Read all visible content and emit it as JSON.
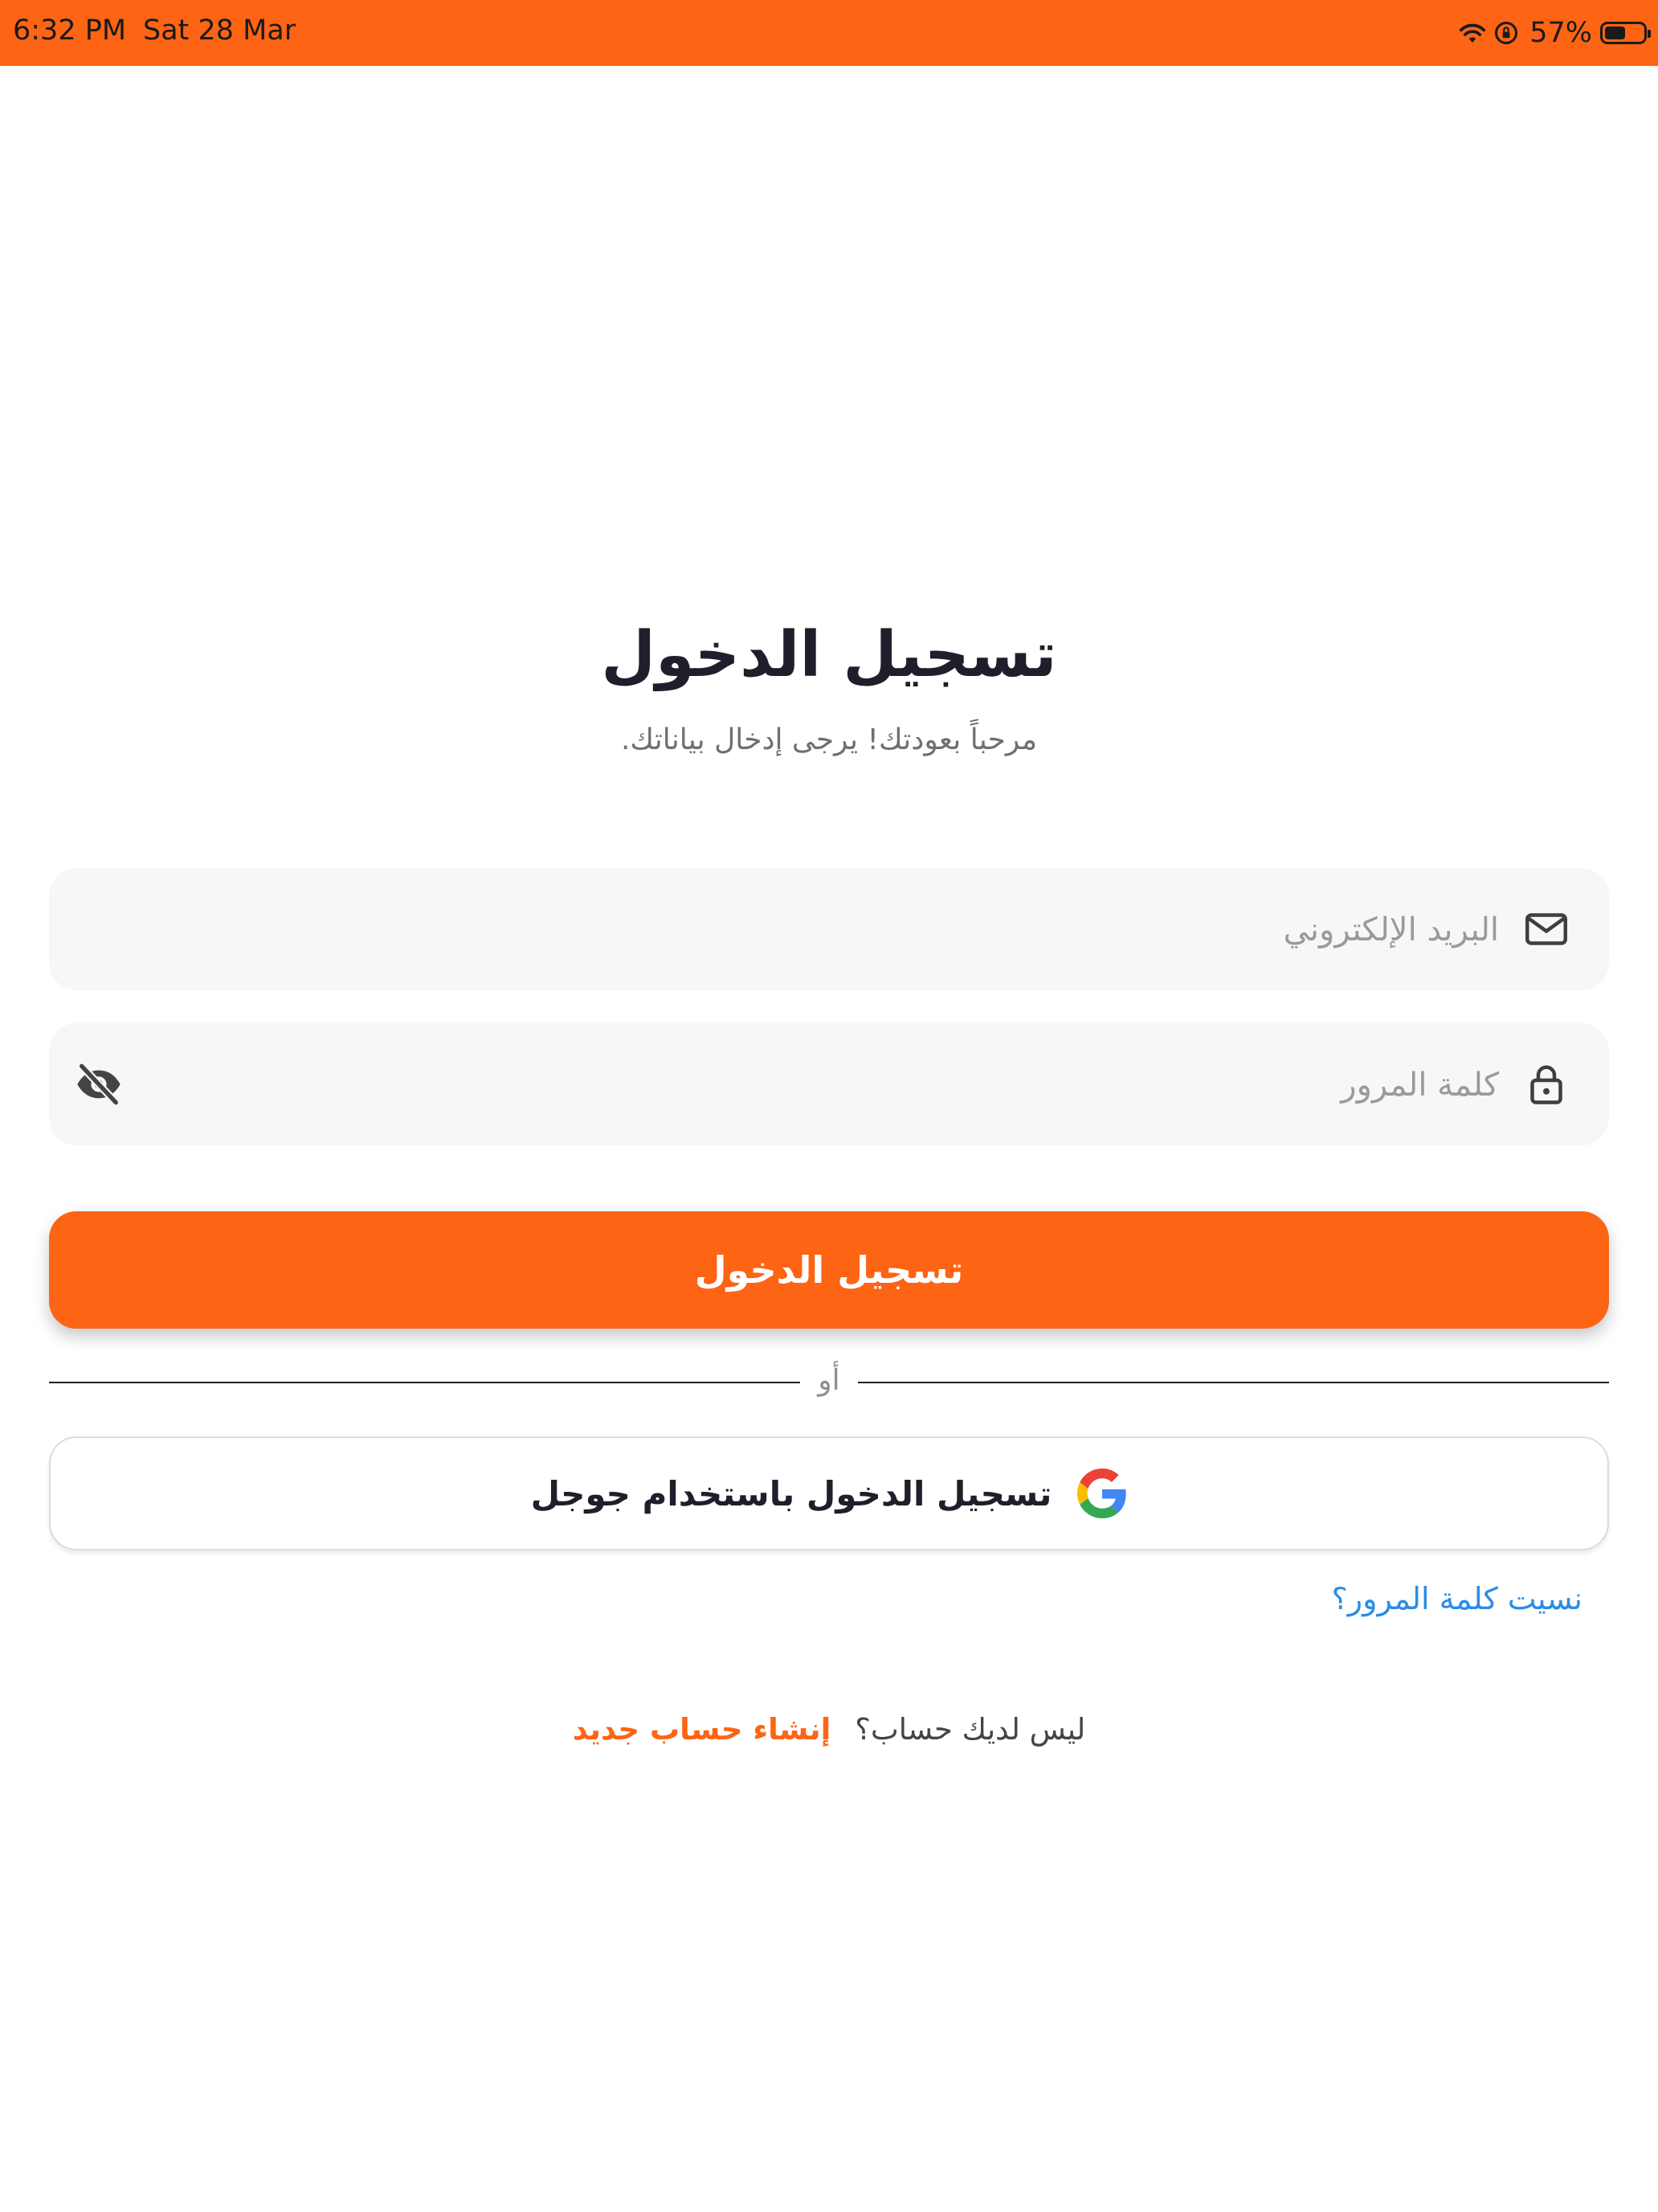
{
  "status_bar": {
    "time": "6:32 PM",
    "date": "Sat 28 Mar",
    "battery_percent": "57%",
    "battery_level": 0.57
  },
  "login": {
    "title": "تسجيل الدخول",
    "subtitle": "مرحباً بعودتك! يرجى إدخال بياناتك.",
    "email_placeholder": "البريد الإلكتروني",
    "email_value": "",
    "password_placeholder": "كلمة المرور",
    "password_value": "",
    "submit_label": "تسجيل الدخول",
    "divider_text": "أو",
    "google_label": "تسجيل الدخول باستخدام جوجل",
    "forgot_password": "نسيت كلمة المرور؟",
    "no_account": "ليس لديك حساب؟",
    "create_account": "إنشاء حساب جديد"
  },
  "colors": {
    "accent": "#fd6414",
    "link": "#2b8ce6",
    "field_bg": "#f7f7f7",
    "title": "#1e1f2b"
  },
  "icons": [
    "wifi-icon",
    "orientation-lock-icon",
    "battery-icon",
    "mail-icon",
    "lock-icon",
    "eye-off-icon",
    "google-icon"
  ]
}
